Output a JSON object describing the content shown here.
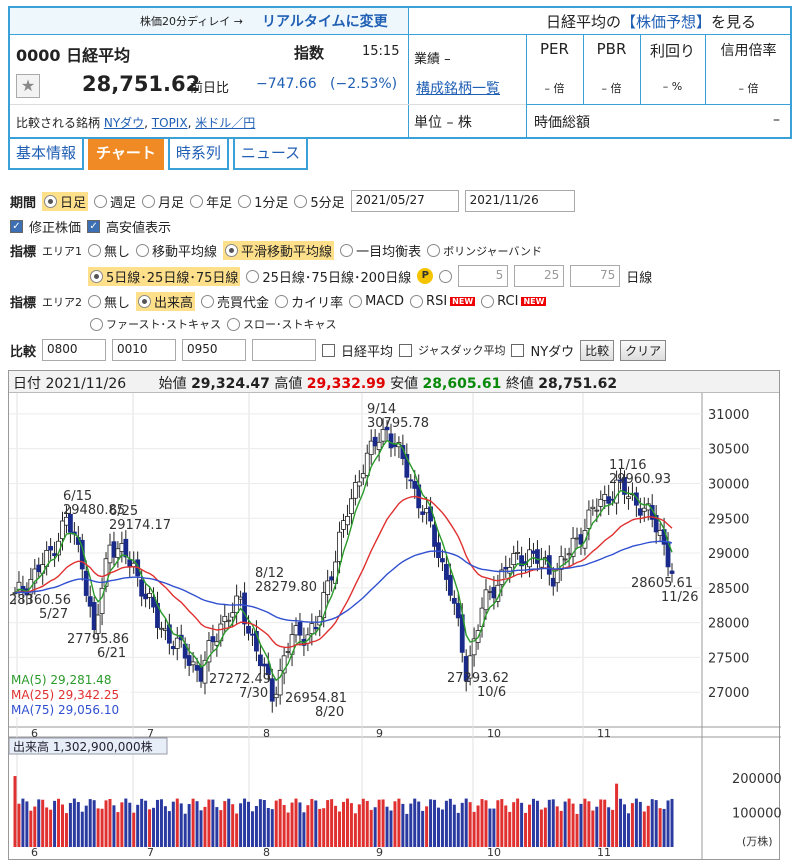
{
  "header": {
    "delay_note": "株価20分ディレイ →",
    "realtime_link": "リアルタイムに変更",
    "nikkei_link_prefix": "日経平均の",
    "forecast_link": "【株価予想】",
    "nikkei_link_suffix": "を見る",
    "code_name": "0000 日経平均",
    "kind": "指数",
    "time": "15:15",
    "price": "28,751.62",
    "prev_label": "前日比",
    "change": "−747.66",
    "change_pct": "(−2.53%)",
    "compare_label": "比較される銘柄",
    "compare_links": [
      "NYダウ",
      "TOPIX",
      "米ドル／円"
    ],
    "gyoseki": "業績 –",
    "composition_link": "構成銘柄一覧",
    "unit": "単位 – 株",
    "metrics": [
      {
        "name": "PER",
        "value": "– 倍"
      },
      {
        "name": "PBR",
        "value": "– 倍"
      },
      {
        "name": "利回り",
        "value": "– %"
      },
      {
        "name": "信用倍率",
        "value": "– 倍"
      }
    ],
    "market_cap_label": "時価総額",
    "market_cap_value": "–"
  },
  "tabs": [
    "基本情報",
    "チャート",
    "時系列",
    "ニュース"
  ],
  "controls": {
    "period_label": "期間",
    "period_options": [
      "日足",
      "週足",
      "月足",
      "年足",
      "1分足",
      "5分足"
    ],
    "date_from": "2021/05/27",
    "date_to": "2021/11/26",
    "check_adjusted": "修正株価",
    "check_highlow": "高安値表示",
    "indicator_label": "指標",
    "area1_label": "エリア1",
    "area1_options": [
      "無し",
      "移動平均線",
      "平滑移動平均線",
      "一目均衡表",
      "ボリンジャーバンド"
    ],
    "ma_options": [
      "5日線･25日線･75日線",
      "25日線･75日線･200日線"
    ],
    "custom_ma": [
      "5",
      "25",
      "75"
    ],
    "custom_ma_suffix": "日線",
    "area2_label": "エリア2",
    "area2_options": [
      "無し",
      "出来高",
      "売買代金",
      "カイリ率",
      "MACD",
      "RSI",
      "RCI"
    ],
    "area2_options2": [
      "ファースト･ストキャス",
      "スロー･ストキャス"
    ],
    "new_badge": "NEW",
    "compare_label": "比較",
    "compare_codes": [
      "0800",
      "0010",
      "0950",
      ""
    ],
    "compare_checks": [
      "日経平均",
      "ジャスダック平均",
      "NYダウ"
    ],
    "compare_button": "比較",
    "clear_button": "クリア"
  },
  "ohlc_bar": {
    "date_label": "日付",
    "date": "2021/11/26",
    "open_label": "始値",
    "open": "29,324.47",
    "high_label": "高値",
    "high": "29,332.99",
    "low_label": "安値",
    "low": "28,605.61",
    "close_label": "終値",
    "close": "28,751.62"
  },
  "chart_data": {
    "type": "candlestick",
    "x_ticks": [
      "6",
      "7",
      "8",
      "9",
      "10",
      "11"
    ],
    "y_ticks": [
      27000,
      27500,
      28000,
      28500,
      29000,
      29500,
      30000,
      30500,
      31000
    ],
    "ylim": [
      26500,
      31300
    ],
    "annotations": [
      {
        "date": "5/27",
        "value": "28360.56"
      },
      {
        "date": "6/15",
        "value": "29480.85"
      },
      {
        "date": "6/25",
        "value": "29174.17"
      },
      {
        "date": "6/21",
        "value": "27795.86"
      },
      {
        "date": "7/30",
        "value": "27272.49"
      },
      {
        "date": "8/12",
        "value": "28279.80"
      },
      {
        "date": "8/20",
        "value": "26954.81"
      },
      {
        "date": "9/14",
        "value": "30795.78"
      },
      {
        "date": "10/6",
        "value": "27293.62"
      },
      {
        "date": "11/16",
        "value": "29960.93"
      },
      {
        "date": "11/26",
        "value": "28605.61"
      }
    ],
    "ma_legend": [
      {
        "name": "MA(5)",
        "value": "29,281.48",
        "color": "#2a9a2a"
      },
      {
        "name": "MA(25)",
        "value": "29,342.25",
        "color": "#e03030"
      },
      {
        "name": "MA(75)",
        "value": "29,056.10",
        "color": "#3050d0"
      }
    ],
    "volume_label": "出来高",
    "volume_value": "1,302,900,000株",
    "volume_ticks": [
      100000,
      200000
    ],
    "volume_unit": "(万株)"
  }
}
